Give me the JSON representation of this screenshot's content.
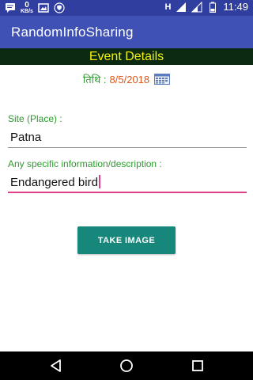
{
  "status_bar": {
    "data_speed_value": "0",
    "data_speed_unit": "KB/s",
    "network_label": "H",
    "time": "11:49"
  },
  "app_bar": {
    "title": "RandomInfoSharing"
  },
  "event": {
    "header": "Event Details",
    "date_label": "तिथि :",
    "date_value": "8/5/2018"
  },
  "form": {
    "site_label": "Site (Place) :",
    "site_value": "Patna",
    "description_label": "Any specific information/description :",
    "description_value": "Endangered bird",
    "take_image_label": "TAKE IMAGE"
  },
  "colors": {
    "status_bar": "#303f9f",
    "app_bar": "#3f51b5",
    "event_header_bg": "#0c2a12",
    "event_header_text": "#f2f20a",
    "label_green": "#2e9a2e",
    "date_orange": "#e0561a",
    "accent_pink": "#e0408a",
    "button_teal": "#16877a"
  },
  "icons": {
    "status_left": [
      "message-icon",
      "image-icon",
      "shield-icon"
    ],
    "status_right": [
      "signal-icon",
      "signal-icon",
      "battery-icon"
    ],
    "date": "calendar-icon",
    "nav": [
      "back-icon",
      "home-icon",
      "recents-icon"
    ]
  }
}
